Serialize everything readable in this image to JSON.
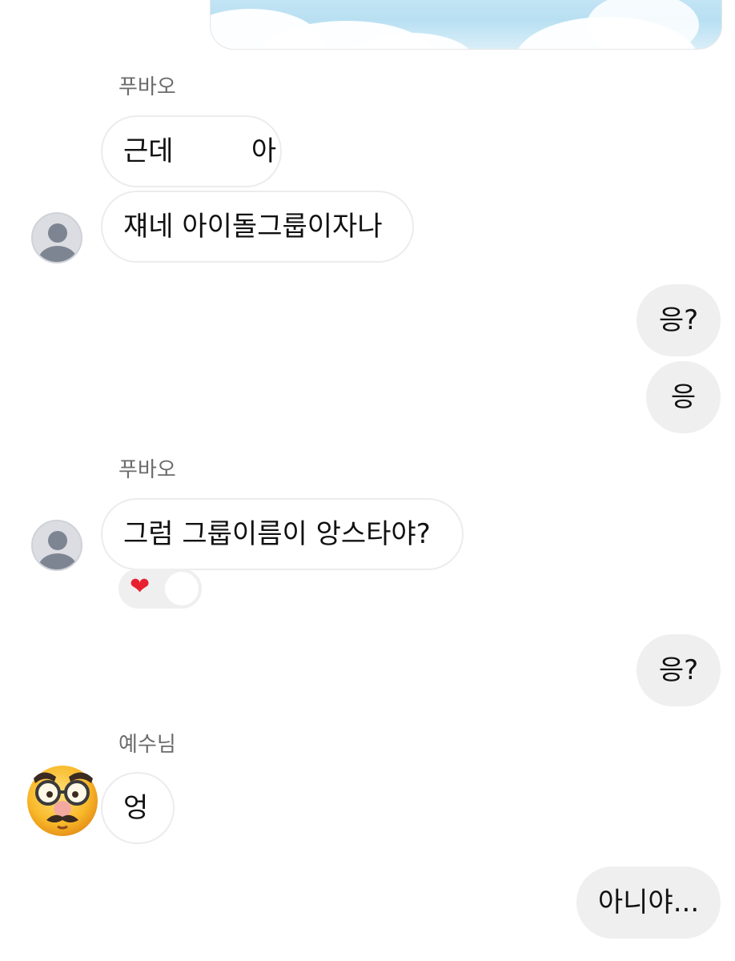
{
  "messages": [
    {
      "sender": "푸바오",
      "text": "근데         아"
    },
    {
      "text": "쟤네 아이돌그룹이자나"
    },
    {
      "text": "응?"
    },
    {
      "text": "응"
    },
    {
      "sender": "푸바오",
      "text": "그럼 그룹이름이 앙스타야?"
    },
    {
      "reaction": "heart"
    },
    {
      "text": "응?"
    },
    {
      "sender": "예수님",
      "text": "엉"
    },
    {
      "text": "아니야..."
    }
  ],
  "icons": {
    "default_avatar": "person-silhouette-icon",
    "sender_avatar_emoji": "disguised-face-icon",
    "reaction": "red-heart-icon"
  },
  "colors": {
    "incoming_bubble": "#ffffff",
    "outgoing_bubble": "#efefef",
    "heart": "#e8202f"
  }
}
